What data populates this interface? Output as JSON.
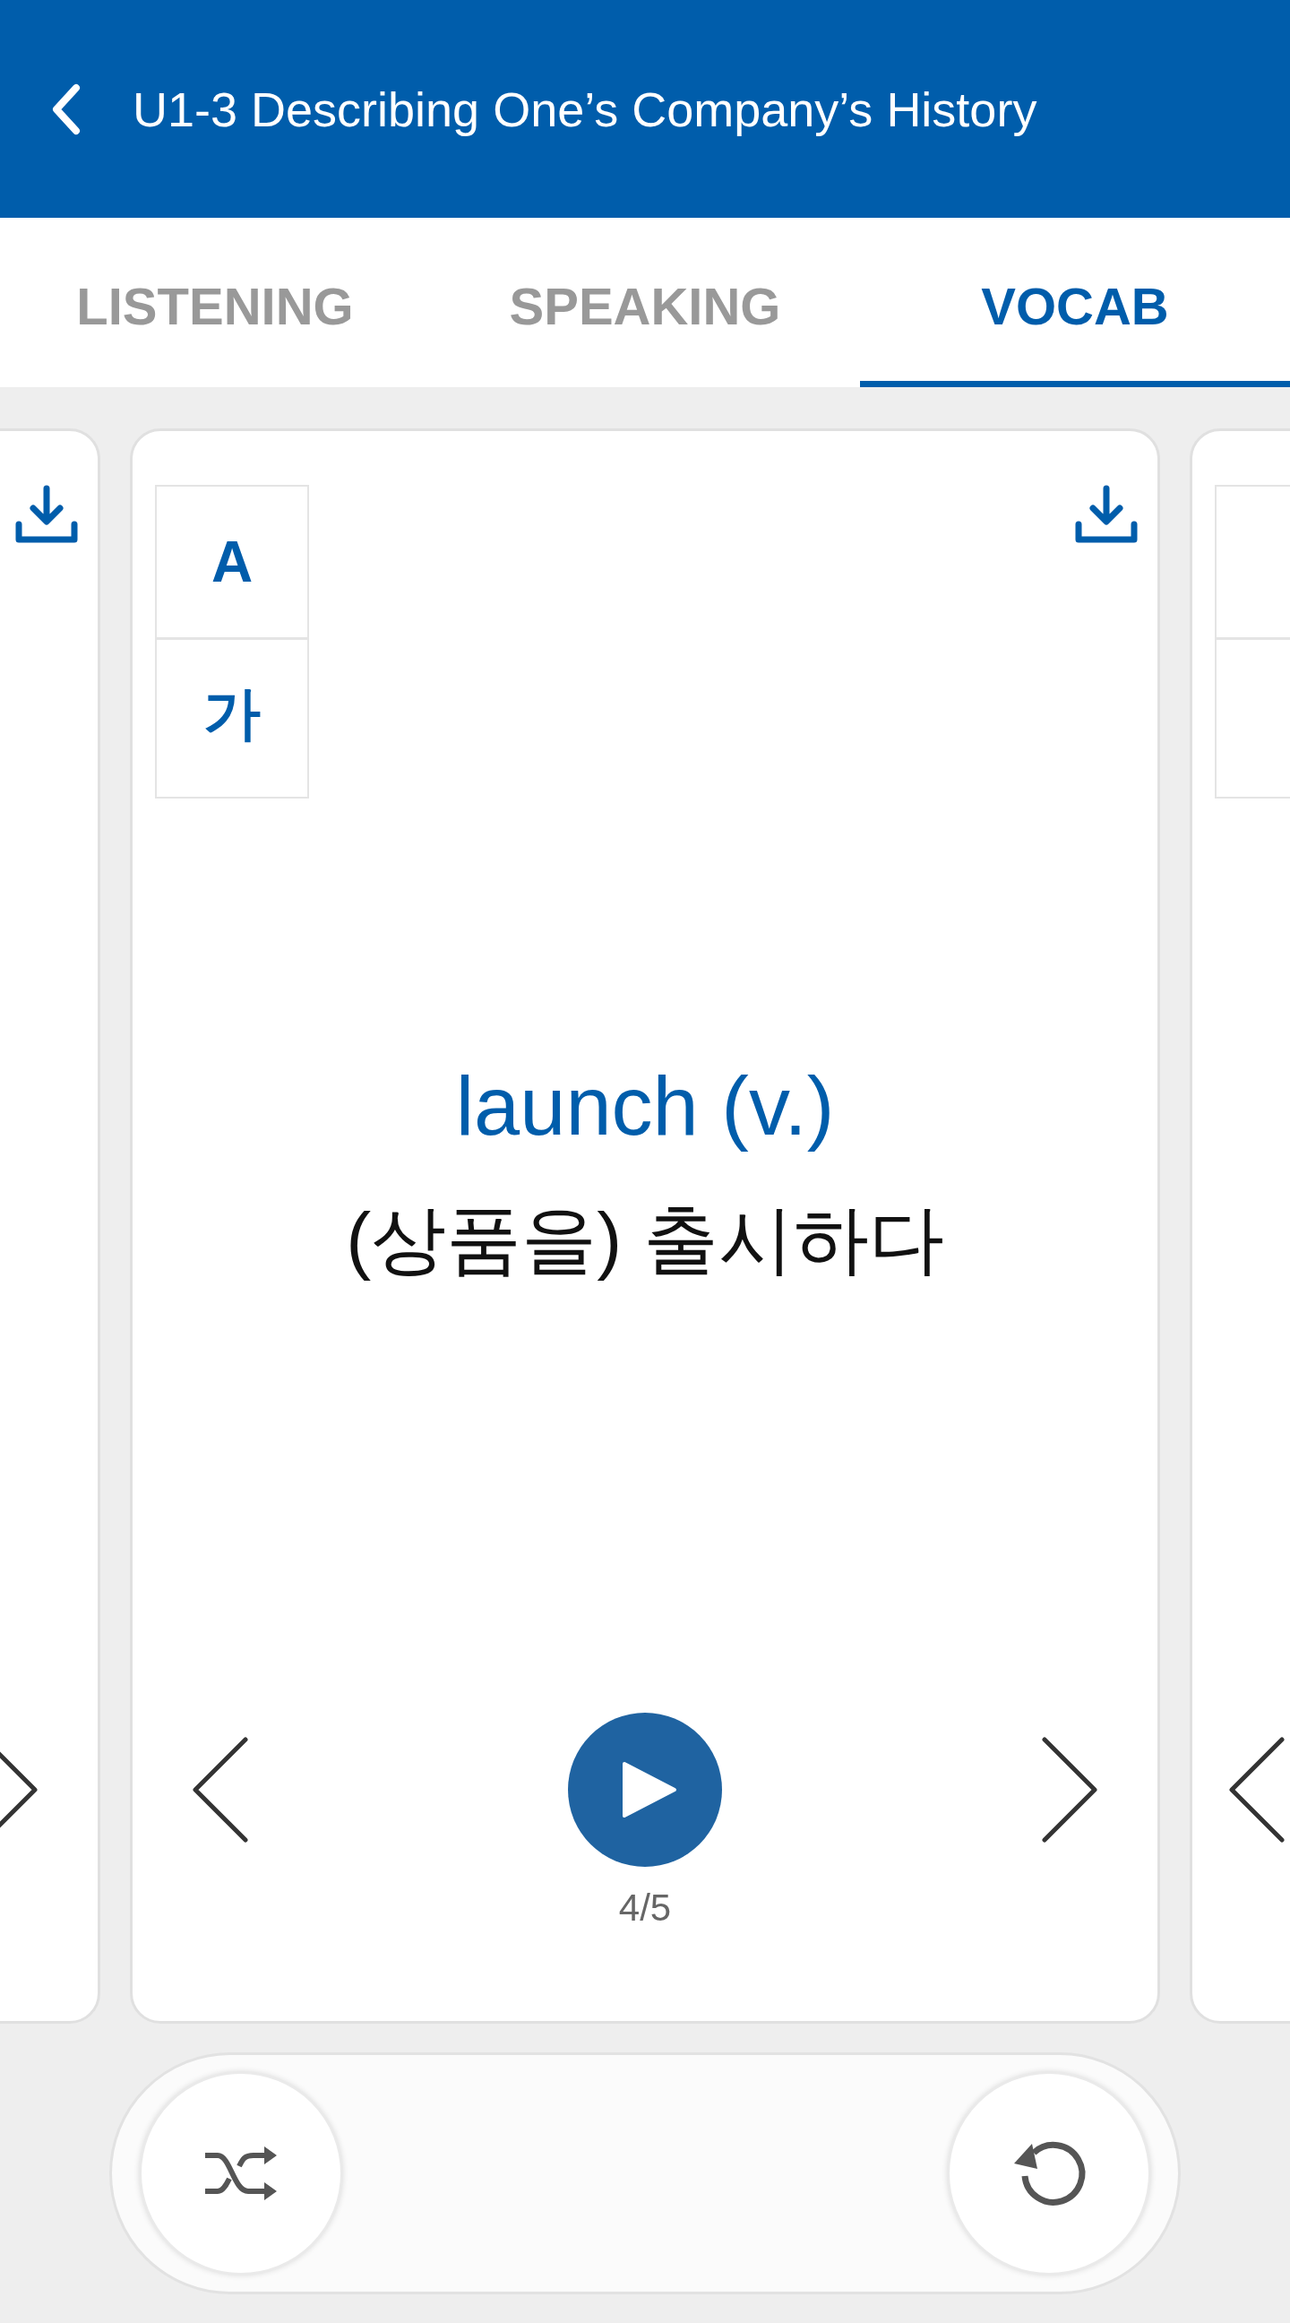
{
  "header": {
    "title": "U1-3 Describing One’s Company’s History"
  },
  "tabs": [
    {
      "label": "LISTENING",
      "selected": false
    },
    {
      "label": "SPEAKING",
      "selected": false
    },
    {
      "label": "VOCAB",
      "selected": true
    }
  ],
  "card": {
    "language_buttons": [
      {
        "label": "A"
      },
      {
        "label": "가"
      }
    ],
    "word": "launch (v.)",
    "meaning": "(상품을) 출시하다",
    "counter": "4/5"
  }
}
